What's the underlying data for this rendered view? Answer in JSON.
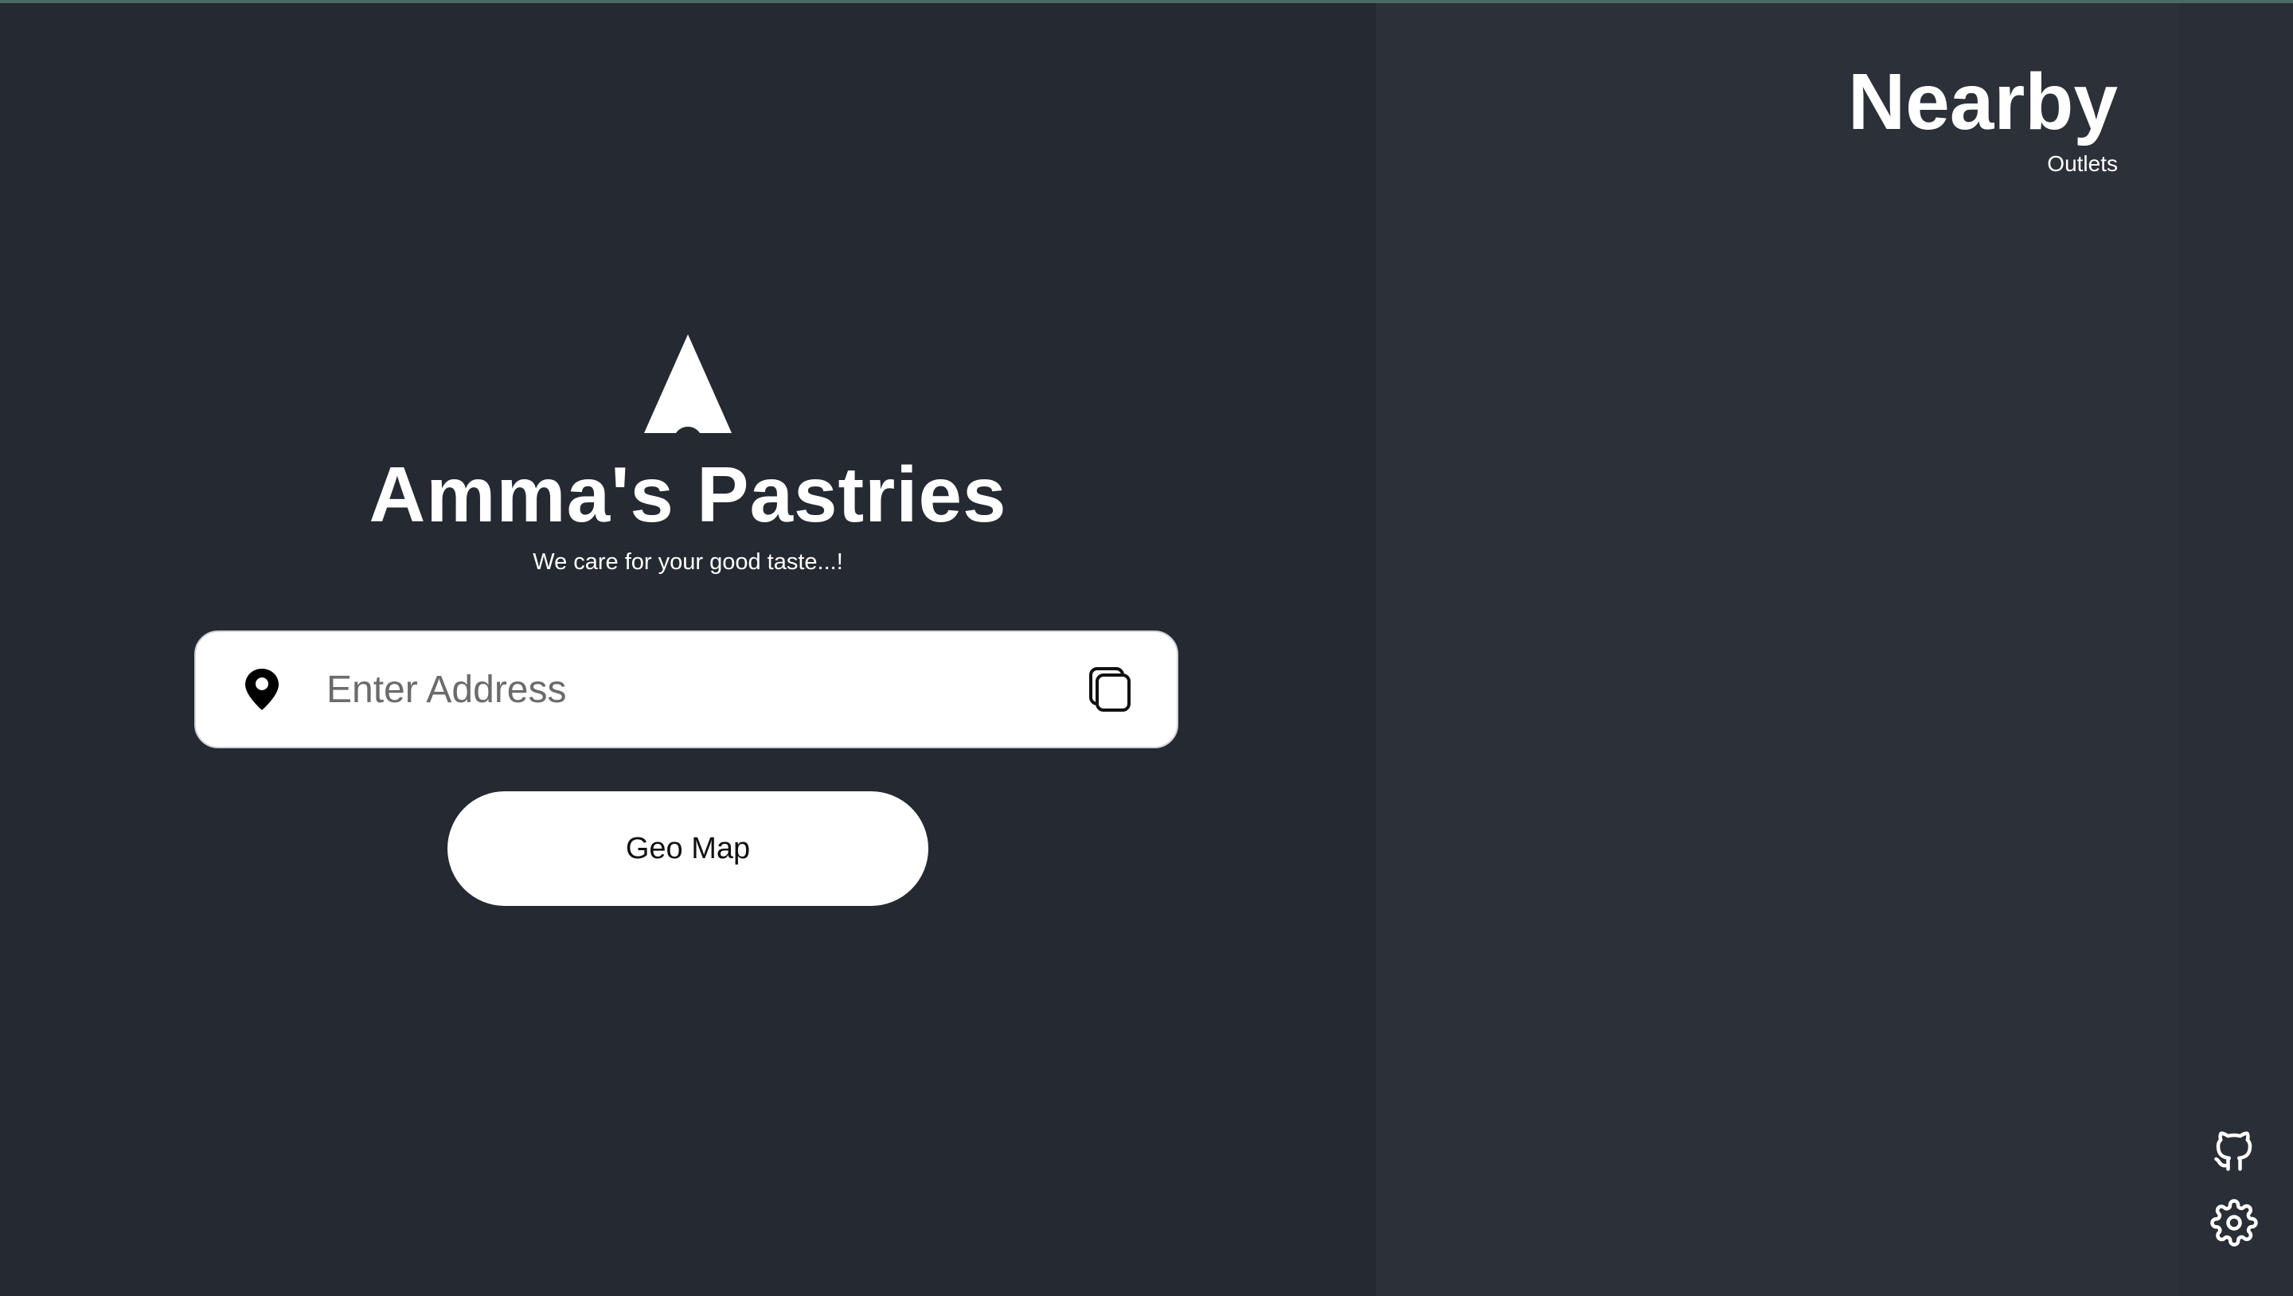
{
  "brand": {
    "title": "Amma's Pastries",
    "tagline": "We care for your good taste...!"
  },
  "address": {
    "placeholder": "Enter Address",
    "value": ""
  },
  "geo_map": {
    "label": "Geo Map"
  },
  "nearby": {
    "title": "Nearby",
    "subtitle": "Outlets"
  },
  "icons": {
    "logo": "triangle-logo-icon",
    "location": "location-pin-icon",
    "copy": "copy-icon",
    "github": "github-icon",
    "settings": "gear-icon"
  },
  "colors": {
    "background": "#252931",
    "sidebar": "#2c3038",
    "accent_line": "#4b6a66",
    "text": "#ffffff"
  }
}
